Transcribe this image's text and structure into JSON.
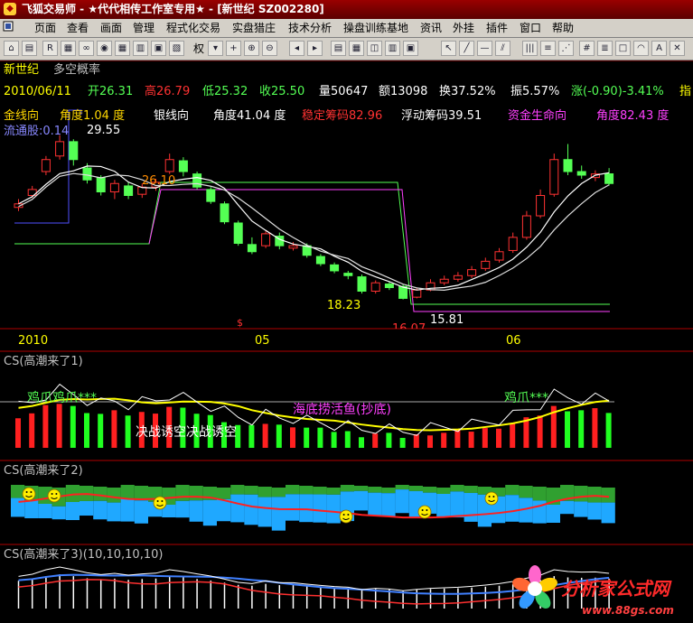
{
  "window": {
    "title": "飞狐交易师 - ★代代相传工作室专用★ - [新世纪 SZ002280]"
  },
  "menu": {
    "items": [
      "页面",
      "查看",
      "画面",
      "管理",
      "程式化交易",
      "实盘猎庄",
      "技术分析",
      "操盘训练基地",
      "资讯",
      "外挂",
      "插件",
      "窗口",
      "帮助"
    ]
  },
  "toolbar": {
    "period_label": "权"
  },
  "stock": {
    "name": "新世纪",
    "indicator": "多空概率",
    "date": "2010/06/11",
    "open": "开26.31",
    "high": "高26.79",
    "low": "低25.32",
    "close": "收25.50",
    "volume": "量50647",
    "amount": "额13098",
    "turnover": "换37.52%",
    "amplitude": "振5.57%",
    "change": "涨(-0.90)-3.41%",
    "trailing": "指"
  },
  "indicators": {
    "gold_line": "金线向",
    "gold_angle": "角度1.04 度",
    "silver_line": "银线向",
    "silver_angle": "角度41.04 度",
    "stable_chips": "稳定筹码82.96",
    "floating_chips": "浮动筹码39.51",
    "fund_life": "资金生命向",
    "fund_angle": "角度82.43 度",
    "circulating": "流通股:0.14",
    "top_value": "29.55"
  },
  "price_labels": {
    "mark1": "26.10",
    "mark2": "18.23",
    "mark3": "15.81",
    "mark4": "16.07",
    "dollar": "$"
  },
  "axis": {
    "labels": [
      "2010",
      "05",
      "06"
    ]
  },
  "panels": {
    "p1_title": "CS(高潮来了1)",
    "p1_text_left": "鸡爪鸡爪***",
    "p1_text_mid": "决战诱空决战诱空",
    "p1_text_center": "海底捞活鱼(抄底)",
    "p1_text_right": "鸡爪***",
    "p2_title": "CS(高潮来了2)",
    "p3_title": "CS(高潮来了3)(10,10,10,10)"
  },
  "watermark": {
    "brand": "分析家公式网",
    "url": "www.88gs.com"
  },
  "colors": {
    "up": "#ff3232",
    "down": "#54ff54",
    "ma_white": "#ffffff",
    "ma_yellow": "#ffff00",
    "panel_border": "#b00000",
    "gold": "#ffd700",
    "magenta": "#ff40ff"
  },
  "chart_data": {
    "type": "candlestick",
    "candles": [
      [
        23.5,
        23.8,
        24.2,
        23.2
      ],
      [
        24.5,
        25.0,
        25.3,
        24.3
      ],
      [
        26.5,
        27.5,
        27.8,
        26.2
      ],
      [
        27.8,
        29.0,
        29.55,
        27.5
      ],
      [
        29.0,
        27.5,
        29.2,
        27.0
      ],
      [
        26.8,
        25.8,
        27.2,
        25.5
      ],
      [
        26.0,
        24.8,
        26.2,
        24.5
      ],
      [
        24.8,
        25.5,
        25.8,
        24.2
      ],
      [
        25.3,
        24.5,
        25.6,
        24.2
      ],
      [
        24.6,
        25.2,
        25.5,
        24.3
      ],
      [
        25.2,
        25.6,
        25.9,
        24.9
      ],
      [
        26.5,
        27.5,
        28.0,
        26.3
      ],
      [
        27.4,
        26.5,
        27.7,
        26.1
      ],
      [
        26.3,
        25.2,
        26.5,
        25.0
      ],
      [
        25.0,
        24.0,
        25.2,
        23.8
      ],
      [
        23.8,
        22.3,
        24.0,
        22.1
      ],
      [
        22.2,
        20.5,
        22.4,
        20.3
      ],
      [
        20.4,
        19.8,
        21.0,
        19.6
      ],
      [
        20.3,
        21.3,
        21.5,
        20.1
      ],
      [
        21.1,
        20.3,
        21.4,
        20.0
      ],
      [
        20.1,
        20.3,
        20.6,
        19.9
      ],
      [
        20.3,
        19.5,
        20.5,
        19.3
      ],
      [
        19.4,
        18.8,
        19.6,
        18.6
      ],
      [
        18.7,
        18.2,
        18.9,
        18.0
      ],
      [
        18.0,
        17.8,
        18.2,
        17.5
      ],
      [
        17.7,
        16.5,
        17.9,
        16.3
      ],
      [
        16.5,
        17.2,
        17.4,
        16.3
      ],
      [
        17.1,
        16.8,
        17.3,
        16.6
      ],
      [
        16.9,
        15.9,
        17.1,
        15.81
      ],
      [
        16.0,
        16.6,
        16.8,
        15.9
      ],
      [
        16.6,
        17.2,
        17.5,
        16.5
      ],
      [
        17.2,
        17.5,
        17.8,
        17.0
      ],
      [
        17.5,
        17.8,
        18.1,
        17.3
      ],
      [
        17.8,
        18.3,
        18.6,
        17.6
      ],
      [
        18.4,
        19.0,
        19.3,
        18.2
      ],
      [
        19.1,
        19.8,
        20.1,
        18.9
      ],
      [
        19.9,
        21.0,
        21.4,
        19.7
      ],
      [
        21.0,
        22.8,
        23.2,
        20.8
      ],
      [
        22.8,
        24.5,
        25.0,
        22.6
      ],
      [
        24.6,
        27.5,
        28.0,
        24.4
      ],
      [
        27.5,
        26.5,
        28.8,
        26.2
      ],
      [
        26.5,
        26.2,
        27.0,
        25.9
      ],
      [
        26.0,
        26.3,
        26.6,
        25.7
      ],
      [
        26.31,
        25.5,
        26.79,
        25.32
      ]
    ],
    "xlabels": [
      "2010",
      "05",
      "06"
    ],
    "ylabel": "",
    "title": ""
  }
}
